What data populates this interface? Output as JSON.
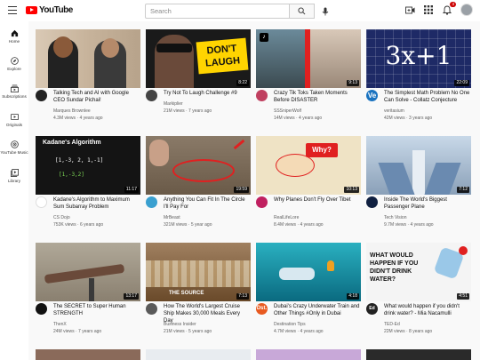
{
  "header": {
    "logo_text": "YouTube",
    "search_placeholder": "Search",
    "notification_count": "3"
  },
  "sidebar": {
    "items": [
      {
        "label": "Home",
        "icon": "home-icon"
      },
      {
        "label": "Explore",
        "icon": "compass-icon"
      },
      {
        "label": "Subscriptions",
        "icon": "subscriptions-icon"
      },
      {
        "label": "Originals",
        "icon": "originals-icon"
      },
      {
        "label": "YouTube Music",
        "icon": "music-icon"
      },
      {
        "label": "Library",
        "icon": "library-icon"
      }
    ]
  },
  "videos": [
    {
      "title": "Talking Tech and AI with Google CEO Sundar Pichai!",
      "channel": "Marques Brownlee",
      "meta": "4.3M views · 4 years ago",
      "duration": "",
      "thumb_color": "#c9b8a5",
      "avatar_color": "#222222"
    },
    {
      "title": "Try Not To Laugh Challenge #9",
      "channel": "Markiplier",
      "meta": "21M views · 7 years ago",
      "duration": "8:22",
      "thumb_color": "#1a1a1a",
      "avatar_color": "#444444",
      "thumb_text": "DON'T LAUGH"
    },
    {
      "title": "Crazy Tik Toks Taken Moments Before DISASTER",
      "channel": "SSSniperWolf",
      "meta": "14M views · 4 years ago",
      "duration": "9:13",
      "thumb_color": "#d8d0c8",
      "avatar_color": "#c04060"
    },
    {
      "title": "The Simplest Math Problem No One Can Solve - Collatz Conjecture",
      "channel": "veritasium",
      "meta": "42M views · 3 years ago",
      "duration": "22:09",
      "thumb_color": "#1e2a66",
      "avatar_color": "#1a73c0",
      "thumb_text": "3x+1"
    },
    {
      "title": "Kadane's Algorithm to Maximum Sum Subarray Problem",
      "channel": "CS Dojo",
      "meta": "753K views · 6 years ago",
      "duration": "11:17",
      "thumb_color": "#141414",
      "avatar_color": "#ffffff",
      "thumb_text": "Kadane's Algorithm"
    },
    {
      "title": "Anything You Can Fit In The Circle I'll Pay For",
      "channel": "MrBeast",
      "meta": "321M views · 5 year ago",
      "duration": "19:59",
      "thumb_color": "#7a6a55",
      "avatar_color": "#3aa0d0"
    },
    {
      "title": "Why Planes Don't Fly Over Tibet",
      "channel": "RealLifeLore",
      "meta": "8.4M views · 4 years ago",
      "duration": "10:13",
      "thumb_color": "#efe3c5",
      "avatar_color": "#c02060",
      "thumb_text": "Why?"
    },
    {
      "title": "Inside The World's Biggest Passenger Plane",
      "channel": "Tech Vision",
      "meta": "9.7M views · 4 years ago",
      "duration": "7:12",
      "thumb_color": "#b8c8d8",
      "avatar_color": "#102040"
    },
    {
      "title": "The SECRET to Super Human STRENGTH",
      "channel": "ThenX",
      "meta": "24M views · 7 years ago",
      "duration": "13:17",
      "thumb_color": "#a8a090",
      "avatar_color": "#111111"
    },
    {
      "title": "How The World's Largest Cruise Ship Makes 30,000 Meals Every Day",
      "channel": "Business Insider",
      "meta": "21M views · 5 years ago",
      "duration": "7:13",
      "thumb_color": "#8a6a4a",
      "avatar_color": "#5a5a5a",
      "thumb_text": "THE SOURCE"
    },
    {
      "title": "Dubai's Crazy Underwater Train and Other Things #Only in Dubai",
      "channel": "Destination Tips",
      "meta": "4.7M views · 4 years ago",
      "duration": "4:18",
      "thumb_color": "#1f9aa8",
      "avatar_color": "#e85a20"
    },
    {
      "title": "What would happen if you didn't drink water? - Mia Nacamulli",
      "channel": "TED-Ed",
      "meta": "22M views · 8 years ago",
      "duration": "4:51",
      "thumb_color": "#f4f4f4",
      "avatar_color": "#222222",
      "thumb_text": "WHAT WOULD HAPPEN IF YOU DIDN'T DRINK WATER?"
    }
  ]
}
